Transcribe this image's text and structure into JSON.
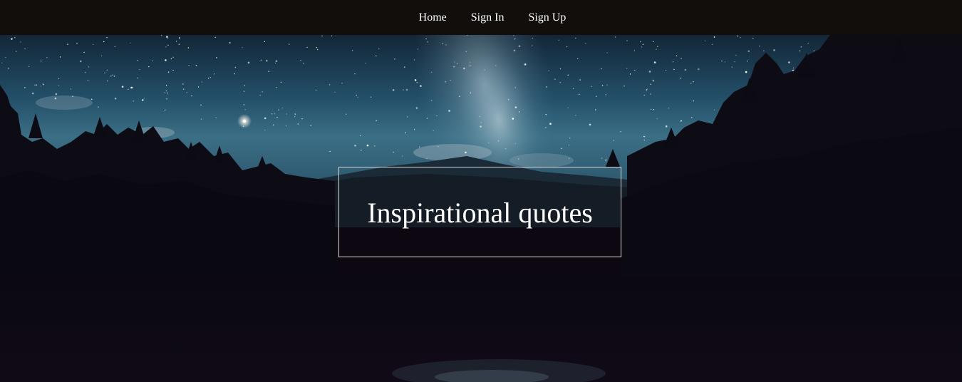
{
  "nav": {
    "items": [
      {
        "label": "Home"
      },
      {
        "label": "Sign In"
      },
      {
        "label": "Sign Up"
      }
    ]
  },
  "hero": {
    "title": "Inspirational quotes",
    "background": "night-sky-milky-way-forest-photo"
  },
  "colors": {
    "navbar": "#120e0c",
    "nav_text": "#ffffff",
    "title_text": "#ffffff",
    "box_border": "#d9d9d9",
    "sky_top": "#0f2233",
    "sky_mid": "#2a5a72",
    "forest": "#0a0710"
  }
}
